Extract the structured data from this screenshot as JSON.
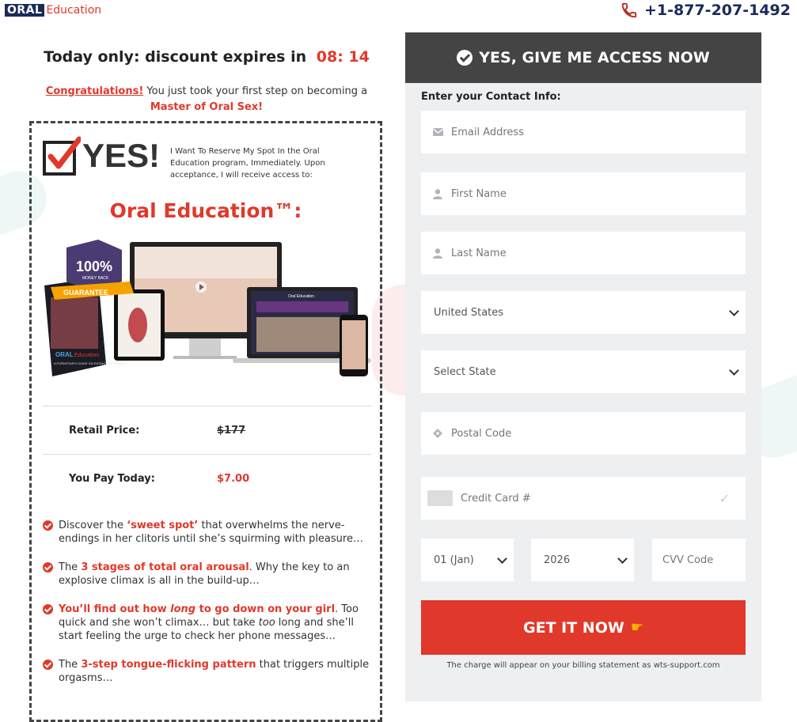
{
  "brand": {
    "oral": "ORAL",
    "education": "Education"
  },
  "phone": "+1-877-207-1492",
  "discount": {
    "text": "Today only: discount expires in",
    "timer": "08: 14"
  },
  "congrats": {
    "highlight": "Congratulations!",
    "text": " You just took your first step on becoming a",
    "master": "Master of Oral Sex!"
  },
  "offer": {
    "yes": "YES!",
    "description": "I Want To Reserve My Spot In the Oral Education program, Immediately. Upon acceptance, I will receive access to:",
    "product_title": "Oral Education™:",
    "retail_label": "Retail Price:",
    "retail_value": "$177",
    "pay_label": "You Pay Today:",
    "pay_value": "$7.00",
    "image_text": {
      "badge_pct": "100%",
      "badge_money": "MONEY BACK",
      "badge_guarantee": "GUARANTEE",
      "book_oral": "ORAL",
      "book_edu": "Education",
      "book_sub": "A PORNSTAR'S GUIDE ON EATING OUT WOMEN",
      "laptop_title": "Oral Education"
    }
  },
  "bullets": [
    {
      "pre": "Discover the ",
      "hl": "‘sweet spot’",
      "post": " that overwhelms the nerve-endings in her clitoris until she’s squirming with pleasure…"
    },
    {
      "pre": "The ",
      "hl": "3 stages of total oral arousal",
      "post": ". Why the key to an explosive climax is all in the build-up…"
    },
    {
      "hl1": "You’ll find out how ",
      "hl_it": "long",
      "hl2": " to go down on your girl",
      "post1": ". Too quick and she won’t climax… but take ",
      "it": "too",
      "post2": " long and she’ll start feeling the urge to check her phone messages…"
    },
    {
      "pre": "The ",
      "hl": "3-step tongue-flicking pattern",
      "post": " that triggers multiple orgasms…"
    }
  ],
  "form": {
    "header": "YES, GIVE ME ACCESS NOW",
    "contact_label": "Enter your Contact Info:",
    "email_placeholder": "Email Address",
    "first_name_placeholder": "First Name",
    "last_name_placeholder": "Last Name",
    "country": "United States",
    "state": "Select State",
    "postal_placeholder": "Postal Code",
    "card_placeholder": "Credit Card #",
    "exp_month": "01 (Jan)",
    "exp_year": "2026",
    "cvv_placeholder": "CVV Code",
    "cta": "GET IT NOW",
    "billing_note": "The charge will appear on your billing statement as wts-support.com"
  },
  "colors": {
    "accent": "#e0392b",
    "navy": "#1a2b5a",
    "header_bg": "#444444",
    "panel_bg": "#eeeff1"
  },
  "icons": [
    "phone-icon",
    "check-circle-icon",
    "envelope-icon",
    "user-icon",
    "map-pin-icon",
    "credit-card-icon",
    "chevron-down-icon",
    "pointing-hand-icon"
  ]
}
